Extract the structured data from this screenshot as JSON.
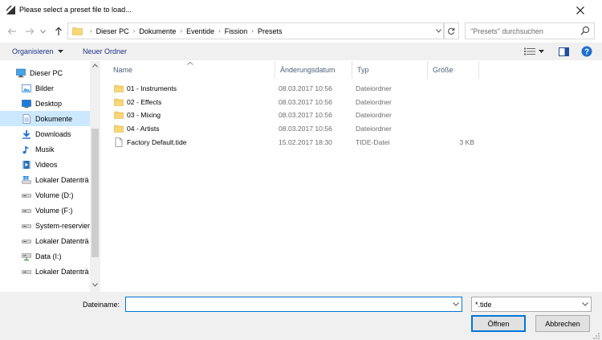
{
  "window": {
    "title": "Please select a preset file to load..."
  },
  "address": {
    "crumbs": [
      "Dieser PC",
      "Dokumente",
      "Eventide",
      "Fission",
      "Presets"
    ]
  },
  "search": {
    "placeholder": "\"Presets\" durchsuchen"
  },
  "toolbar": {
    "organize_label": "Organisieren",
    "new_folder_label": "Neuer Ordner"
  },
  "sidebar": {
    "items": [
      {
        "label": "Dieser PC",
        "icon": "computer-icon",
        "level": 0,
        "selected": false
      },
      {
        "label": "Bilder",
        "icon": "pictures-icon",
        "level": 1,
        "selected": false
      },
      {
        "label": "Desktop",
        "icon": "desktop-icon",
        "level": 1,
        "selected": false
      },
      {
        "label": "Dokumente",
        "icon": "documents-icon",
        "level": 1,
        "selected": true
      },
      {
        "label": "Downloads",
        "icon": "download-icon",
        "level": 1,
        "selected": false
      },
      {
        "label": "Musik",
        "icon": "music-icon",
        "level": 1,
        "selected": false
      },
      {
        "label": "Videos",
        "icon": "video-icon",
        "level": 1,
        "selected": false
      },
      {
        "label": "Lokaler Datenträ",
        "icon": "windows-drive-icon",
        "level": 1,
        "selected": false
      },
      {
        "label": "Volume (D:)",
        "icon": "drive-icon",
        "level": 1,
        "selected": false
      },
      {
        "label": "Volume (F:)",
        "icon": "drive-icon",
        "level": 1,
        "selected": false
      },
      {
        "label": "System-reservier",
        "icon": "drive-icon",
        "level": 1,
        "selected": false
      },
      {
        "label": "Lokaler Datenträ",
        "icon": "drive-icon",
        "level": 1,
        "selected": false
      },
      {
        "label": "Data (I:)",
        "icon": "network-drive-icon",
        "level": 1,
        "selected": false
      },
      {
        "label": "Lokaler Datenträ",
        "icon": "drive-icon",
        "level": 1,
        "selected": false
      }
    ]
  },
  "columns": {
    "name": "Name",
    "date": "Änderungsdatum",
    "type": "Typ",
    "size": "Größe"
  },
  "files": [
    {
      "name": "01 - Instruments",
      "date": "08.03.2017 10:56",
      "type": "Dateiordner",
      "size": "",
      "icon": "folder-icon"
    },
    {
      "name": "02 - Effects",
      "date": "08.03.2017 10:56",
      "type": "Dateiordner",
      "size": "",
      "icon": "folder-icon"
    },
    {
      "name": "03 - Mixing",
      "date": "08.03.2017 10:56",
      "type": "Dateiordner",
      "size": "",
      "icon": "folder-icon"
    },
    {
      "name": "04 - Artists",
      "date": "08.03.2017 10:56",
      "type": "Dateiordner",
      "size": "",
      "icon": "folder-icon"
    },
    {
      "name": "Factory Default.tide",
      "date": "15.02.2017 18:30",
      "type": "TIDE-Datei",
      "size": "3 KB",
      "icon": "file-icon"
    }
  ],
  "footer": {
    "filename_label": "Dateiname:",
    "filename_value": "",
    "filter": ".tide",
    "open_label": "Öffnen",
    "cancel_label": "Abbrechen"
  },
  "colors": {
    "accent": "#0078d7",
    "selected": "#cce8ff",
    "folder": "#f8d775",
    "link": "#1e3287"
  }
}
